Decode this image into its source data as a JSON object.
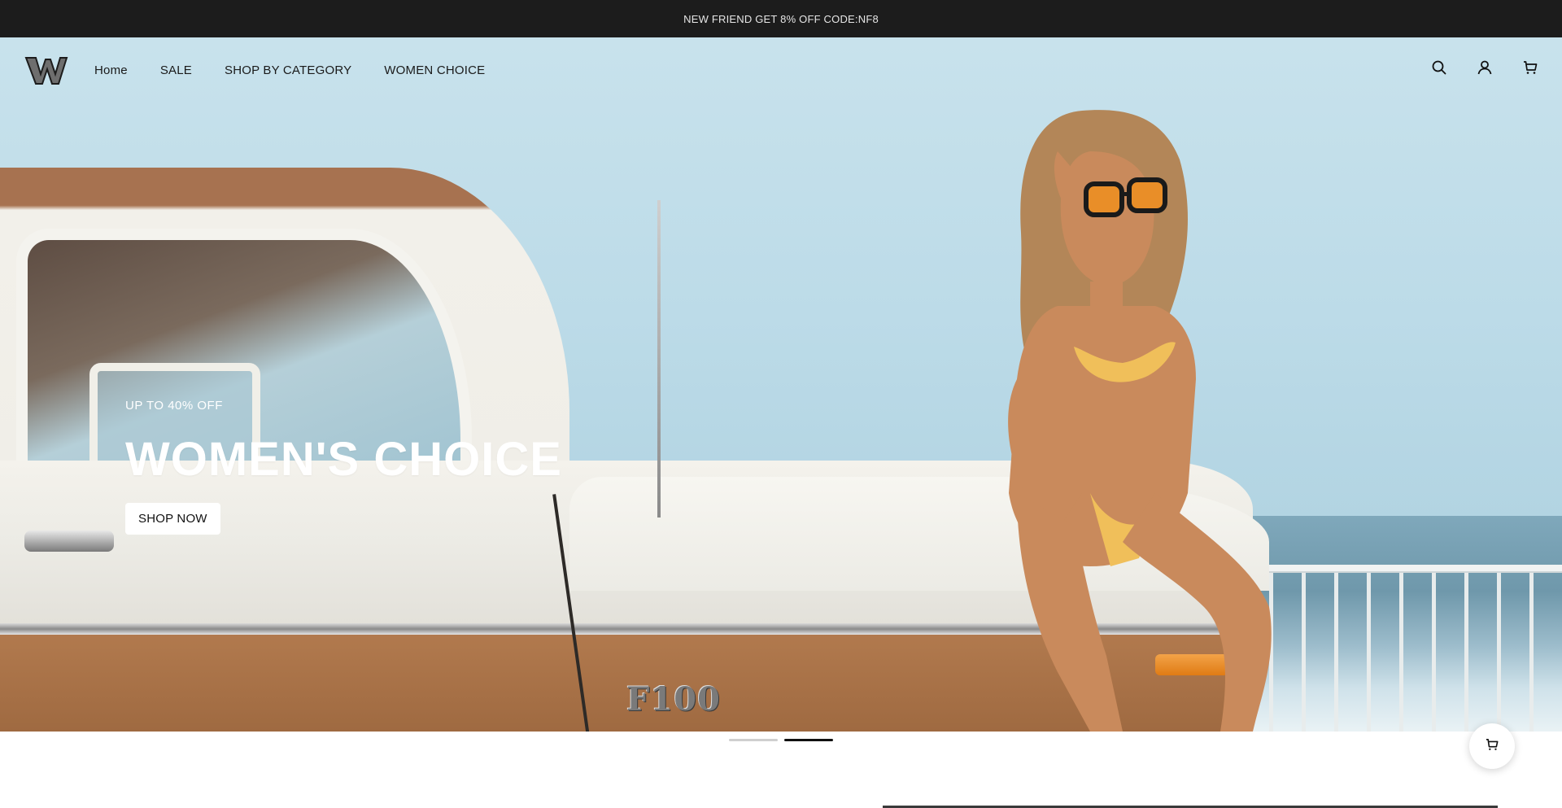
{
  "announcement": {
    "text": "NEW FRIEND GET 8% OFF CODE:NF8"
  },
  "header": {
    "logo_icon": "w-logo-icon",
    "nav": [
      {
        "label": "Home"
      },
      {
        "label": "SALE"
      },
      {
        "label": "SHOP BY CATEGORY"
      },
      {
        "label": "WOMEN CHOICE"
      }
    ],
    "icons": [
      "search-icon",
      "account-icon",
      "cart-icon"
    ]
  },
  "hero": {
    "eyebrow": "UP TO 40% OFF",
    "headline": "WOMEN'S CHOICE",
    "cta_label": "SHOP NOW",
    "truck_badge": "F100",
    "slides": {
      "count": 2,
      "active_index": 1
    }
  },
  "floating_cart": {
    "icon": "cart-icon"
  },
  "colors": {
    "announcement_bg": "#1c1c1c",
    "accent": "#111111",
    "button_bg": "#ffffff"
  }
}
